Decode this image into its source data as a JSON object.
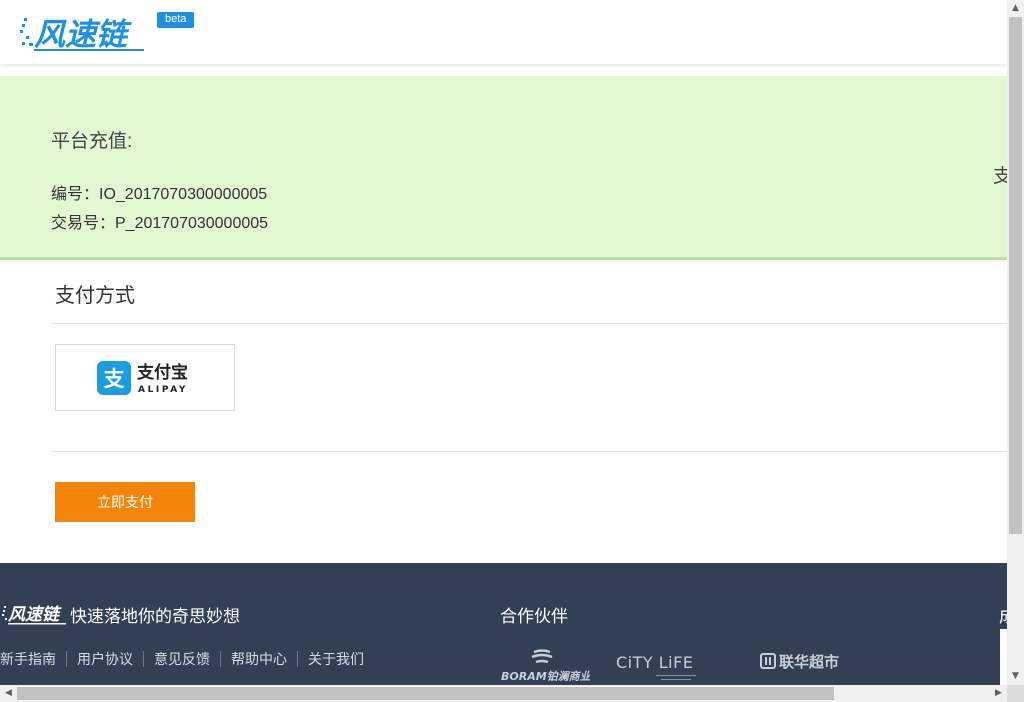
{
  "header": {
    "logo_text": "风速链",
    "beta_badge": "beta"
  },
  "order": {
    "title": "平台充值:",
    "order_number": "编号：IO_2017070300000005",
    "trade_number": "交易号：P_201707030000005",
    "side_text": "支"
  },
  "payment": {
    "section_title": "支付方式",
    "alipay_cn": "支付宝",
    "alipay_en": "ALIPAY",
    "pay_button": "立即支付"
  },
  "footer": {
    "logo_text": "风速链",
    "slogan": "快速落地你的奇思妙想",
    "links": [
      "新手指南",
      "用户协议",
      "意见反馈",
      "帮助中心",
      "关于我们"
    ],
    "partners_title": "合作伙伴",
    "partners": {
      "boram": "BORAM铂澜商业",
      "citylife": "CiTY LiFE",
      "lianhua": "联华超市"
    },
    "right_partial": "成"
  },
  "colors": {
    "brand_blue": "#1f8fe0",
    "banner_green": "#e1f8d3",
    "pay_orange": "#f5850a",
    "footer_bg": "#323f55"
  },
  "icons": {
    "alipay": "alipay-logo-icon",
    "scroll_up": "arrow-up-icon",
    "scroll_down": "arrow-down-icon",
    "scroll_left": "arrow-left-icon",
    "scroll_right": "arrow-right-icon"
  }
}
